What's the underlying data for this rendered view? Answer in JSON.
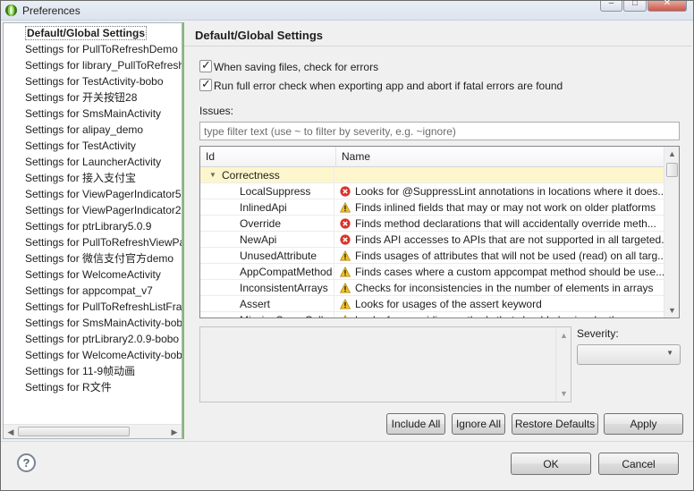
{
  "window": {
    "title": "Preferences",
    "controls": {
      "minimize": "–",
      "maximize": "□",
      "close": "✕"
    }
  },
  "sidebar": {
    "items": [
      {
        "label": "Default/Global Settings",
        "selected": true
      },
      {
        "label": "Settings for PullToRefreshDemo"
      },
      {
        "label": "Settings for library_PullToRefresh"
      },
      {
        "label": "Settings for TestActivity-bobo"
      },
      {
        "label": "Settings for 开关按钮28"
      },
      {
        "label": "Settings for SmsMainActivity"
      },
      {
        "label": "Settings for alipay_demo"
      },
      {
        "label": "Settings for TestActivity"
      },
      {
        "label": "Settings for LauncherActivity"
      },
      {
        "label": "Settings for 接入支付宝"
      },
      {
        "label": "Settings for ViewPagerIndicator5."
      },
      {
        "label": "Settings for ViewPagerIndicator2."
      },
      {
        "label": "Settings for ptrLibrary5.0.9"
      },
      {
        "label": "Settings for PullToRefreshViewPa"
      },
      {
        "label": "Settings for 微信支付官方demo"
      },
      {
        "label": "Settings for WelcomeActivity"
      },
      {
        "label": "Settings for appcompat_v7"
      },
      {
        "label": "Settings for PullToRefreshListFrag"
      },
      {
        "label": "Settings for SmsMainActivity-bob"
      },
      {
        "label": "Settings for ptrLibrary2.0.9-bobo"
      },
      {
        "label": "Settings for WelcomeActivity-bob"
      },
      {
        "label": "Settings for 11-9帧动画"
      },
      {
        "label": "Settings for R文件"
      }
    ]
  },
  "main": {
    "title": "Default/Global Settings",
    "options": {
      "check_on_save": "When saving files, check for errors",
      "check_on_export": "Run full error check when exporting app and abort if fatal errors are found"
    },
    "issues_label": "Issues:",
    "filter_placeholder": "type filter text (use ~ to filter by severity, e.g. ~ignore)",
    "columns": {
      "id": "Id",
      "name": "Name"
    },
    "category": "Correctness",
    "rows": [
      {
        "id": "LocalSuppress",
        "severity": "error",
        "name": "Looks for @SuppressLint annotations in locations where it does..."
      },
      {
        "id": "InlinedApi",
        "severity": "warning",
        "name": "Finds inlined fields that may or may not work on older platforms"
      },
      {
        "id": "Override",
        "severity": "error",
        "name": "Finds method declarations that will accidentally override meth..."
      },
      {
        "id": "NewApi",
        "severity": "error",
        "name": "Finds API accesses to APIs that are not supported in all targeted..."
      },
      {
        "id": "UnusedAttribute",
        "severity": "warning",
        "name": "Finds usages of attributes that will not be used (read) on all targ..."
      },
      {
        "id": "AppCompatMethod",
        "severity": "warning",
        "name": "Finds cases where a custom appcompat method should be use..."
      },
      {
        "id": "InconsistentArrays",
        "severity": "warning",
        "name": "Checks for inconsistencies in the number of elements in arrays"
      },
      {
        "id": "Assert",
        "severity": "warning",
        "name": "Looks for usages of the assert keyword"
      },
      {
        "id": "MissingSuperCall",
        "severity": "warning",
        "name": "Looks for overriding methods that should also invoke the paren..."
      }
    ],
    "severity_label": "Severity:",
    "buttons": {
      "include_all": "Include All",
      "ignore_all": "Ignore All",
      "restore_defaults": "Restore Defaults",
      "apply": "Apply"
    }
  },
  "footer": {
    "help": "?",
    "ok": "OK",
    "cancel": "Cancel"
  },
  "colors": {
    "error": "#d9332a",
    "warning": "#f0c020",
    "category_bg": "#fdf6cc",
    "sash": "#7fbf63"
  }
}
